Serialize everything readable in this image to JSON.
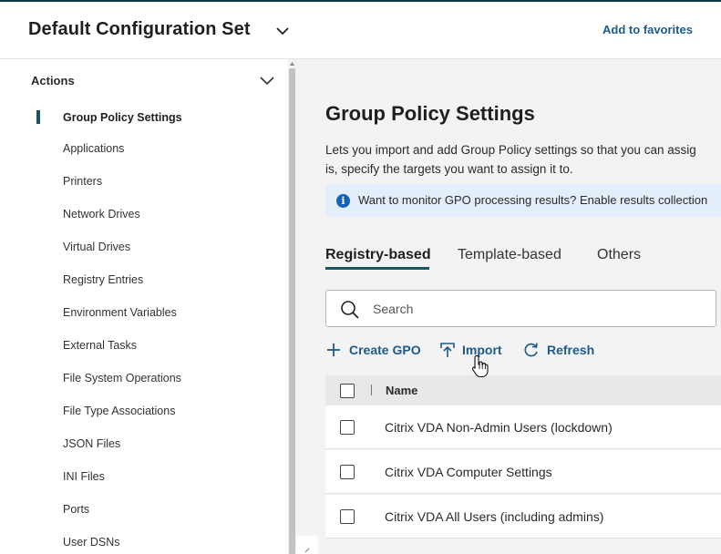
{
  "header": {
    "title": "Default Configuration Set",
    "favorites_label": "Add to favorites",
    "icons": {
      "dropdown": "chevron-down-icon"
    }
  },
  "sidebar": {
    "section_title": "Actions",
    "items": [
      {
        "label": "Group Policy Settings",
        "active": true
      },
      {
        "label": "Applications"
      },
      {
        "label": "Printers"
      },
      {
        "label": "Network Drives"
      },
      {
        "label": "Virtual Drives"
      },
      {
        "label": "Registry Entries"
      },
      {
        "label": "Environment Variables"
      },
      {
        "label": "External Tasks"
      },
      {
        "label": "File System Operations"
      },
      {
        "label": "File Type Associations"
      },
      {
        "label": "JSON Files"
      },
      {
        "label": "INI Files"
      },
      {
        "label": "Ports"
      },
      {
        "label": "User DSNs"
      }
    ]
  },
  "main": {
    "title": "Group Policy Settings",
    "description_line1": "Lets you import and add Group Policy settings so that you can assig",
    "description_line2": "is, specify the targets you want to assign it to.",
    "info_banner": "Want to monitor GPO processing results? Enable results collection",
    "tabs": [
      {
        "label": "Registry-based",
        "active": true
      },
      {
        "label": "Template-based"
      },
      {
        "label": "Others"
      }
    ],
    "search": {
      "placeholder": "Search"
    },
    "actions": {
      "create": "Create GPO",
      "import": "Import",
      "refresh": "Refresh"
    },
    "table": {
      "columns": [
        "Name"
      ],
      "rows": [
        {
          "name": "Citrix VDA Non-Admin Users (lockdown)"
        },
        {
          "name": "Citrix VDA Computer Settings"
        },
        {
          "name": "Citrix VDA All Users (including admins)"
        }
      ]
    }
  },
  "colors": {
    "accent": "#17575e",
    "link": "#1d5a8c",
    "info_bg": "#e3eefa",
    "info_icon": "#1462b8",
    "main_bg": "#f3f3f3"
  }
}
